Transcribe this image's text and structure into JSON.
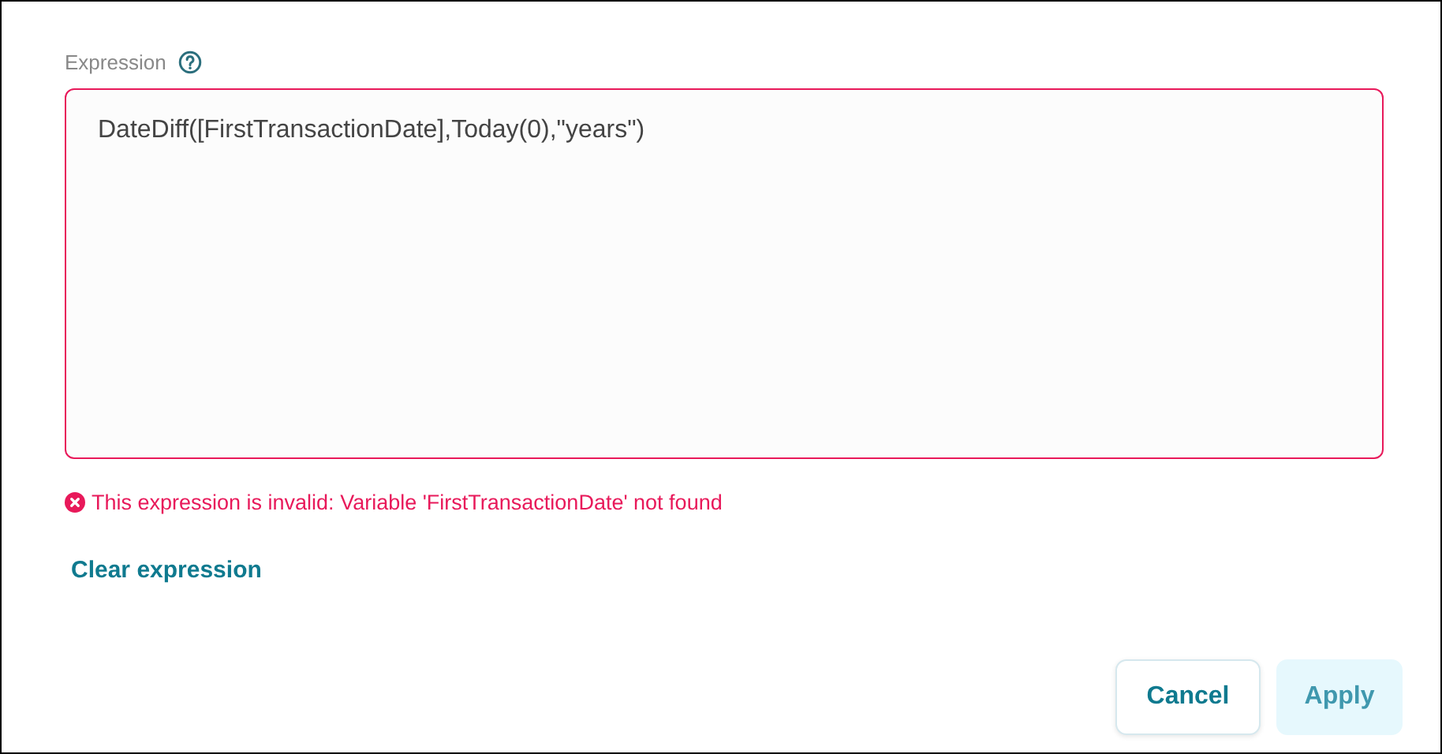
{
  "expression": {
    "label": "Expression",
    "value": "DateDiff([FirstTransactionDate],Today(0),\"years\")",
    "invalid": true,
    "error": "This expression is invalid: Variable 'FirstTransactionDate' not found"
  },
  "clear_link": "Clear expression",
  "buttons": [
    {
      "label": "Cancel",
      "kind": "secondary",
      "disabled": false
    },
    {
      "label": "Apply",
      "kind": "primary",
      "disabled": true
    }
  ]
}
